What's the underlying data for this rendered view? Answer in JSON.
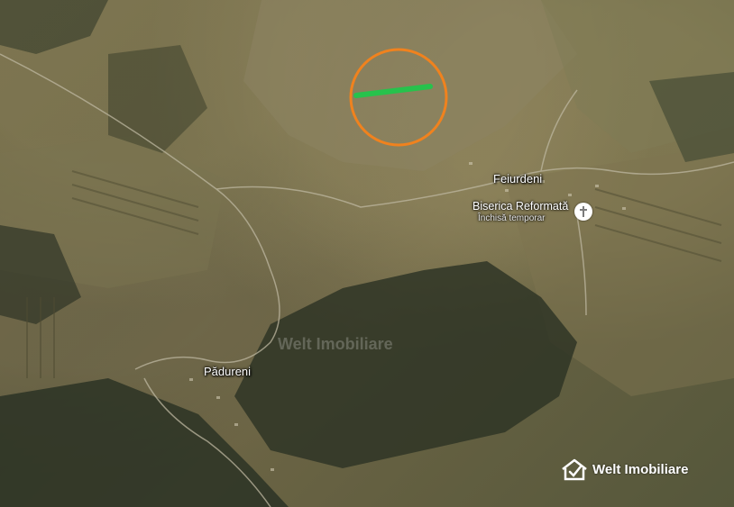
{
  "map": {
    "places": {
      "feiurdeni": "Feiurdeni",
      "padureni": "Pădureni"
    },
    "poi": {
      "name": "Biserica Reformată",
      "status": "Închisă temporar",
      "icon": "church-cross-icon"
    },
    "watermark": "Welt Imobiliare",
    "brand": {
      "name": "Welt Imobiliare",
      "icon": "house-check-logo-icon"
    },
    "highlight": {
      "circle_color": "#f0821e",
      "line_color": "#27c24c"
    }
  }
}
